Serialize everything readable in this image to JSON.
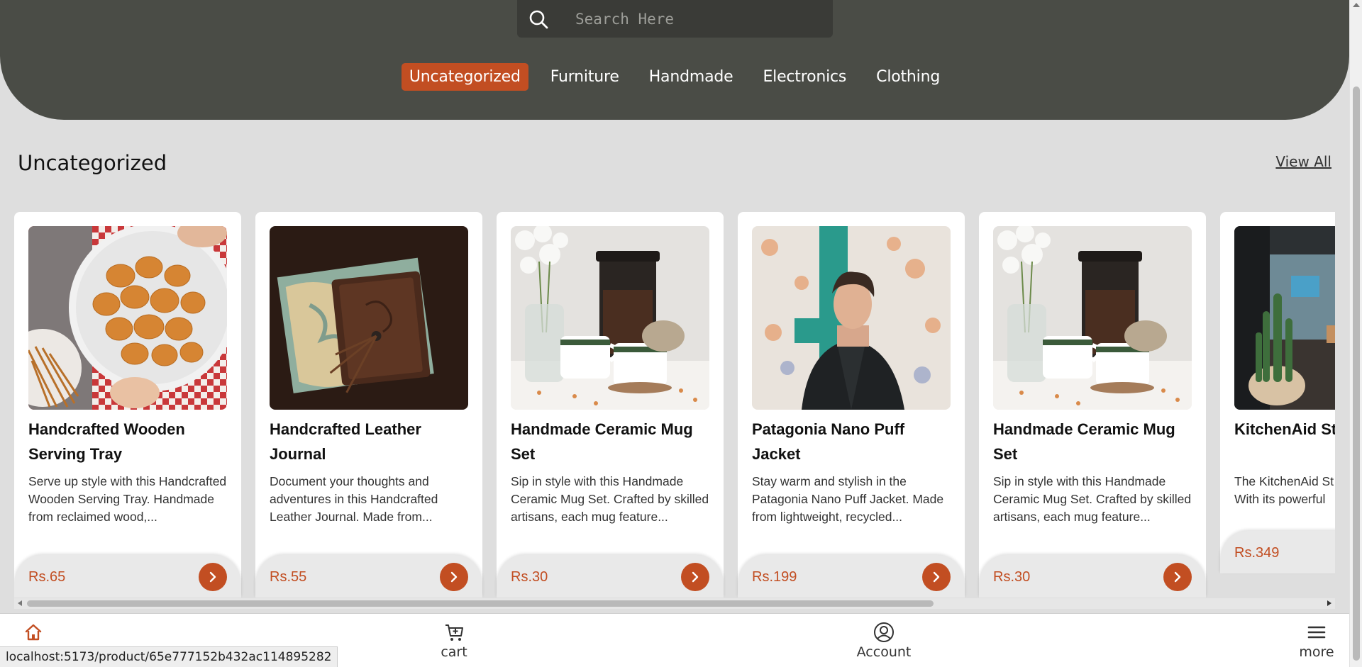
{
  "search": {
    "placeholder": "Search Here"
  },
  "categories": [
    {
      "label": "Uncategorized",
      "active": true
    },
    {
      "label": "Furniture",
      "active": false
    },
    {
      "label": "Handmade",
      "active": false
    },
    {
      "label": "Electronics",
      "active": false
    },
    {
      "label": "Clothing",
      "active": false
    }
  ],
  "section": {
    "title": "Uncategorized",
    "view_all_label": "View All"
  },
  "products": [
    {
      "title": "Handcrafted Wooden Serving Tray",
      "description": "Serve up style with this Handcrafted Wooden Serving Tray. Handmade from reclaimed wood,...",
      "price": "Rs.65"
    },
    {
      "title": "Handcrafted Leather Journal",
      "description": "Document your thoughts and adventures in this Handcrafted Leather Journal. Made from...",
      "price": "Rs.55"
    },
    {
      "title": "Handmade Ceramic Mug Set",
      "description": "Sip in style with this Handmade Ceramic Mug Set. Crafted by skilled artisans, each mug feature...",
      "price": "Rs.30"
    },
    {
      "title": "Patagonia Nano Puff Jacket",
      "description": "Stay warm and stylish in the Patagonia Nano Puff Jacket. Made from lightweight, recycled...",
      "price": "Rs.199"
    },
    {
      "title": "Handmade Ceramic Mug Set",
      "description": "Sip in style with this Handmade Ceramic Mug Set. Crafted by skilled artisans, each mug feature...",
      "price": "Rs.30"
    },
    {
      "title": "KitchenAid St",
      "description": "The KitchenAid St must-have for any With its powerful",
      "price": "Rs.349"
    }
  ],
  "bottom_nav": {
    "home": {
      "label": "home",
      "icon": "home-icon"
    },
    "cart": {
      "label": "cart",
      "icon": "cart-icon"
    },
    "account": {
      "label": "Account",
      "icon": "account-icon"
    },
    "more": {
      "label": "more",
      "icon": "menu-icon"
    }
  },
  "status_url": "localhost:5173/product/65e777152b432ac114895282",
  "colors": {
    "accent": "#c24e22",
    "hero_bg": "#4a4c46",
    "page_bg": "#dedede"
  }
}
